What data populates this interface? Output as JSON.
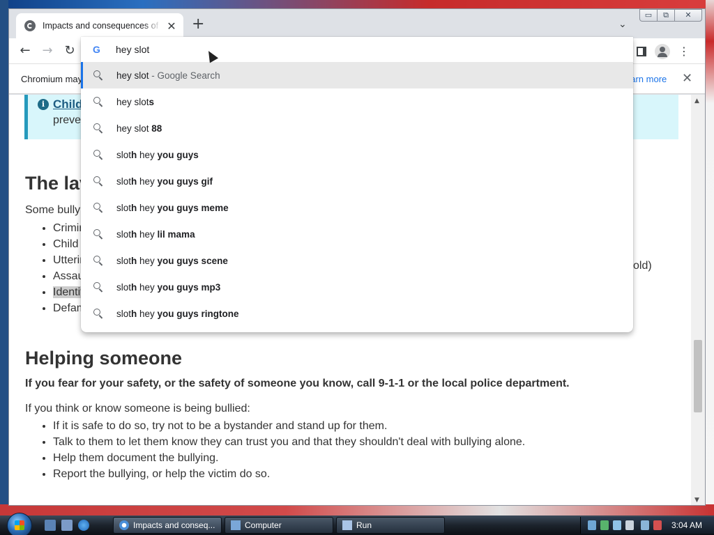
{
  "browser": {
    "tab_title": "Impacts and consequences of bullying",
    "tab_close": "✕",
    "new_tab": "+",
    "tab_list": "⌄",
    "window_controls": {
      "min": "▭",
      "max": "⧉",
      "close": "✕"
    },
    "nav": {
      "back": "←",
      "forward": "→",
      "reload": "↻"
    },
    "toolbar_right": {
      "menu": "⋮"
    }
  },
  "infobar": {
    "message": "Chromium may",
    "learn_more": "earn more",
    "close": "✕"
  },
  "omnibox": {
    "value": "hey slot",
    "google_icon": "G",
    "suggestions": [
      {
        "plain": "hey slot",
        "bold": "",
        "suffix": " - Google Search"
      },
      {
        "plain": "hey slot",
        "bold": "s",
        "suffix": ""
      },
      {
        "plain": "hey slot ",
        "bold": "88",
        "suffix": ""
      },
      {
        "plain": "slot",
        "bold": "h",
        "rest_plain": " hey ",
        "rest_bold": "you guys"
      },
      {
        "plain": "slot",
        "bold": "h",
        "rest_plain": " hey ",
        "rest_bold": "you guys gif"
      },
      {
        "plain": "slot",
        "bold": "h",
        "rest_plain": " hey ",
        "rest_bold": "you guys meme"
      },
      {
        "plain": "slot",
        "bold": "h",
        "rest_plain": " hey ",
        "rest_bold": "lil mama"
      },
      {
        "plain": "slot",
        "bold": "h",
        "rest_plain": " hey ",
        "rest_bold": "you guys scene"
      },
      {
        "plain": "slot",
        "bold": "h",
        "rest_plain": " hey ",
        "rest_bold": "you guys mp3"
      },
      {
        "plain": "slot",
        "bold": "h",
        "rest_plain": " hey ",
        "rest_bold": "you guys ringtone"
      }
    ]
  },
  "page": {
    "alert_link": "Childr",
    "alert_text": "preven",
    "law_heading": "The lav",
    "law_intro": "Some bullyi",
    "law_items": [
      "Crimir",
      "Child",
      "Utterin",
      "Assau",
      "Identit",
      "Defam"
    ],
    "law_item_tail": "old)",
    "helping_heading": "Helping someone",
    "helping_bold": "If you fear for your safety, or the safety of someone you know, call 9-1-1 or the local police department.",
    "helping_intro": "If you think or know someone is being bullied:",
    "helping_items": [
      "If it is safe to do so, try not to be a bystander and stand up for them.",
      "Talk to them to let them know they can trust you and that they shouldn't deal with bullying alone.",
      "Help them document the bullying.",
      "Report the bullying, or help the victim do so."
    ]
  },
  "taskbar": {
    "tasks": [
      {
        "label": "Impacts and conseq..."
      },
      {
        "label": "Computer"
      },
      {
        "label": "Run"
      }
    ],
    "clock": "3:04 AM"
  }
}
